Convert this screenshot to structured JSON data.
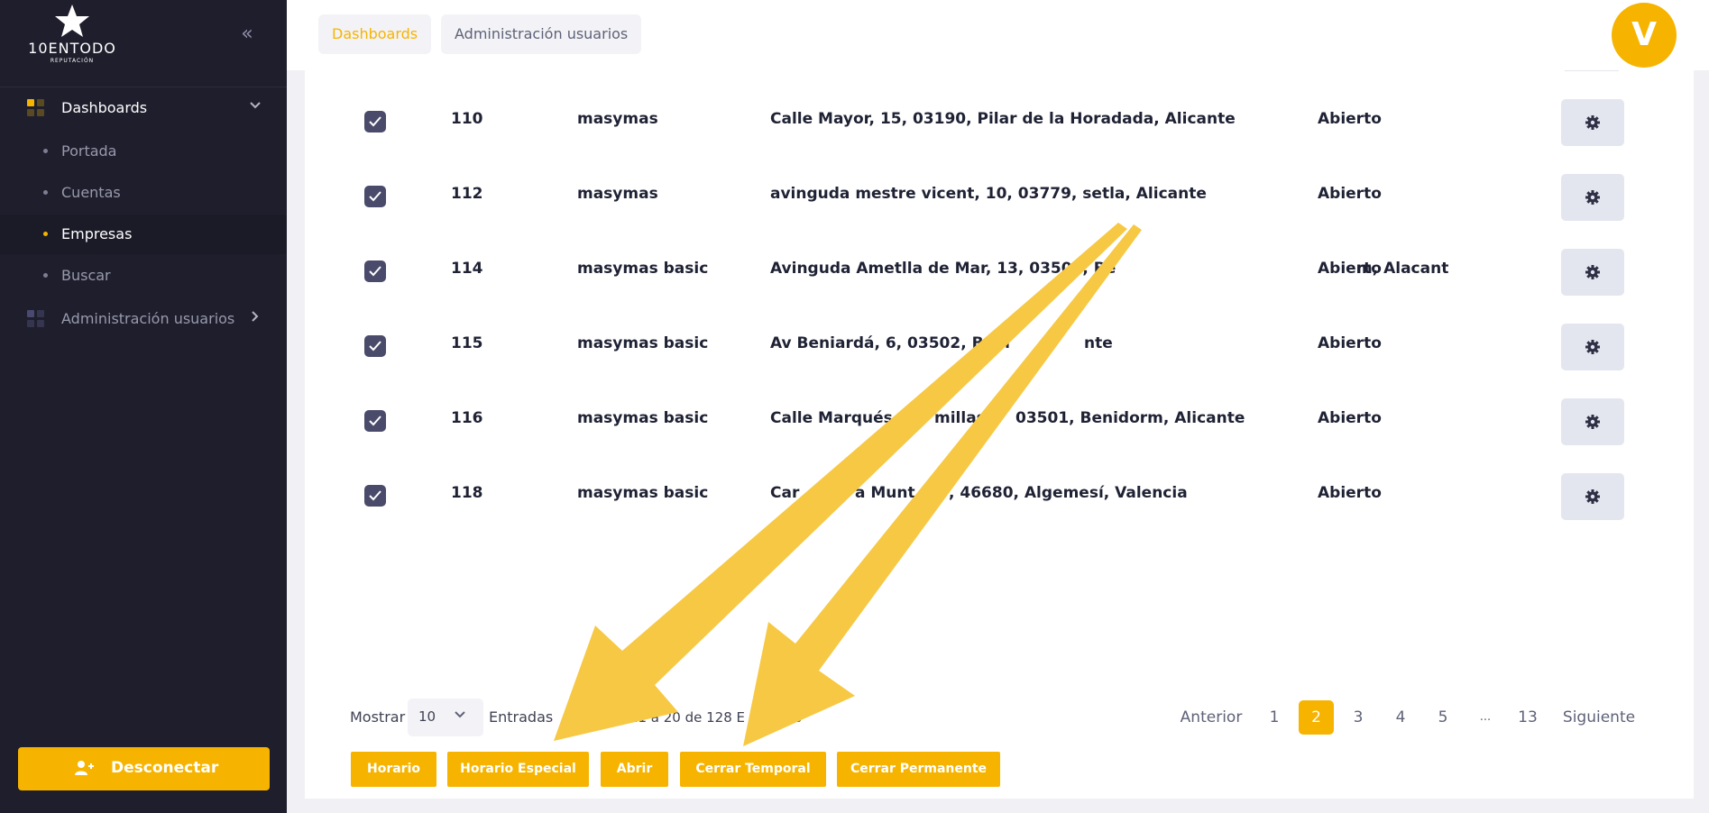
{
  "sidebar": {
    "logo": {
      "brand": "10ENTODO",
      "sub": "REPUTACIÓN"
    },
    "collapse_icon": "double-chevron-left",
    "menu": {
      "dashboards": {
        "label": "Dashboards",
        "icon": "grid-squares"
      },
      "subitems": [
        {
          "label": "Portada"
        },
        {
          "label": "Cuentas"
        },
        {
          "label": "Empresas",
          "active": true
        },
        {
          "label": "Buscar"
        }
      ],
      "admin": {
        "label": "Administración usuarios",
        "icon": "grid-squares"
      }
    },
    "logout_label": "Desconectar"
  },
  "header": {
    "tabs": [
      {
        "label": "Dashboards",
        "active": true
      },
      {
        "label": "Administración usuarios",
        "active": false
      }
    ],
    "avatar_letter": "V"
  },
  "table": {
    "rows": [
      {
        "id": "110",
        "plan": "masymas",
        "address": "Calle Mayor, 15, 03190, Pilar de la Horadada, Alicante",
        "status": "Abierto",
        "checked": true
      },
      {
        "id": "112",
        "plan": "masymas",
        "address": "avinguda mestre vicent, 10, 03779, setla, Alicante",
        "status": "Abierto",
        "checked": true
      },
      {
        "id": "114",
        "plan": "masymas basic",
        "address": "Avinguda Ametlla de Mar, 13, 03503, Be",
        "address_end": "m, Alacant",
        "status": "Abierto",
        "checked": true
      },
      {
        "id": "115",
        "plan": "masymas basic",
        "address": "Av Beniardá, 6, 03502, Beni",
        "address_end": "nte",
        "status": "Abierto",
        "checked": true
      },
      {
        "id": "116",
        "plan": "masymas basic",
        "address": "Calle Marqués",
        "address_end": "millas",
        "address_end2": "03501, Benidorm, Alicante",
        "status": "Abierto",
        "checked": true
      },
      {
        "id": "118",
        "plan": "masymas basic",
        "address": "Car",
        "address_end": "a Munt",
        "address_end2": ", 46680, Algemesí, Valencia",
        "status": "Abierto",
        "checked": true
      }
    ]
  },
  "footer": {
    "show_label": "Mostrar",
    "page_size": "10",
    "entries_label": "Entradas",
    "info_text": "o 11 a 20 de 128 E",
    "info_end": "s",
    "pagination": {
      "prev": "Anterior",
      "pages": [
        "1",
        "2",
        "3",
        "4",
        "5",
        "...",
        "13"
      ],
      "current": "2",
      "next": "Siguiente"
    },
    "actions": [
      "Horario",
      "Horario Especial",
      "Abrir",
      "Cerrar Temporal",
      "Cerrar Permanente"
    ]
  },
  "colors": {
    "accent": "#f6b400",
    "sidebar_bg": "#1e1e2d",
    "arrow": "#f7c843"
  }
}
